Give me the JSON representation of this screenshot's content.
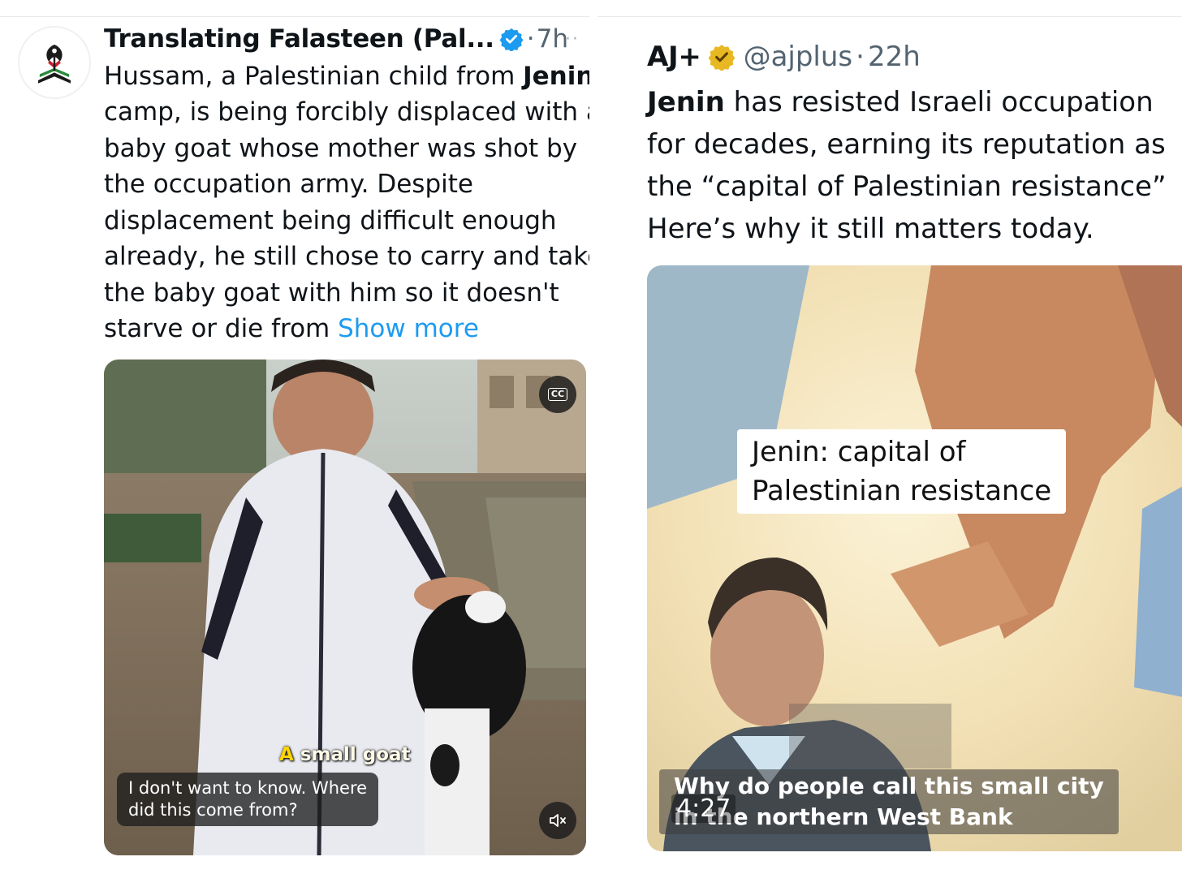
{
  "left_tweet": {
    "author_name": "Translating Falasteen (Pal...",
    "separator": "·",
    "time": "7h",
    "more_icon": "ellipsis-icon",
    "verified_color": "#1d9bf0",
    "text_lines": [
      {
        "plain": "Hussam, a Palestinian child from ",
        "bold": "Jenin"
      },
      {
        "plain": "camp, is being forcibly displaced with a"
      },
      {
        "plain": "baby goat whose mother was shot by"
      },
      {
        "plain": "the occupation army. Despite"
      },
      {
        "plain": "displacement being difficult enough"
      },
      {
        "plain": "already, he still chose to carry and take"
      },
      {
        "plain": "the baby goat with him so it doesn't"
      },
      {
        "plain": "starve or die from ",
        "link": "Show more"
      }
    ],
    "media": {
      "cc_label": "CC",
      "burned_caption_prefix": "A",
      "burned_caption_rest": " small goat",
      "caption_line1": "I don't want to know. Where",
      "caption_line2": "did this come from?",
      "mute_icon": "muted-speaker-icon"
    }
  },
  "right_tweet": {
    "author_name": "AJ+",
    "handle": "@ajplus",
    "separator": "·",
    "time": "22h",
    "verified_color": "#e8b823",
    "text_lines": [
      {
        "bold": "Jenin",
        "plain": " has resisted Israeli occupation"
      },
      {
        "plain": "for decades, earning its reputation as"
      },
      {
        "plain": "the “capital of Palestinian resistance”"
      },
      {
        "plain": "Here’s why it still matters today."
      }
    ],
    "media": {
      "label_line1": "Jenin: capital of",
      "label_line2": "Palestinian resistance",
      "subtitle_line1": "Why do people call this small city",
      "subtitle_line2": "in the northern West Bank",
      "duration": "4:27"
    }
  }
}
